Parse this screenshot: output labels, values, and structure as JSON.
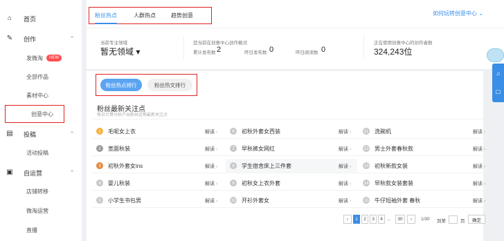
{
  "sidebar": {
    "items": [
      {
        "label": "首页",
        "icon": "home-icon"
      },
      {
        "label": "创作",
        "icon": "pen-icon"
      },
      {
        "label": "发微淘",
        "badge": "NEW"
      },
      {
        "label": "全部作品"
      },
      {
        "label": "素材中心"
      },
      {
        "label": "创意中心"
      },
      {
        "label": "投稿",
        "icon": "document-icon"
      },
      {
        "label": "活动投稿"
      },
      {
        "label": "自运营",
        "icon": "shop-icon"
      },
      {
        "label": "店铺转移"
      },
      {
        "label": "微淘运营"
      },
      {
        "label": "直播"
      }
    ]
  },
  "tabs": [
    "粉丝热点",
    "人群热点",
    "趋势创意"
  ],
  "help_link": "如何玩转创意中心 ⌄",
  "stats": {
    "domain_label": "当前专注领域",
    "domain_value": "暂无领域 ▾",
    "overview_label": "您当前在创意中心创作概况",
    "total_label": "累计发布数",
    "total_value": "2",
    "yesterday_pub_label": "昨日发布数",
    "yesterday_pub_value": "0",
    "yesterday_read_label": "昨日阅读数",
    "yesterday_read_value": "0",
    "users_label": "正在使用创意中心的创作者数",
    "users_value": "324,243位"
  },
  "rank_buttons": [
    "粉丝热点排行",
    "粉丝热文排行"
  ],
  "section": {
    "title": "粉丝最新关注点",
    "subtitle": "每日计算分析产出粉丝近期最新关注点"
  },
  "interpret_label": "解读",
  "hot_items": [
    {
      "num": "1",
      "text": "毛呢女上衣"
    },
    {
      "num": "2",
      "text": "宽面秋装"
    },
    {
      "num": "3",
      "text": "初秋外套女ins"
    },
    {
      "num": "4",
      "text": "婴儿秋装"
    },
    {
      "num": "5",
      "text": "小学生书包男"
    },
    {
      "num": "6",
      "text": "初秋外套女西装"
    },
    {
      "num": "7",
      "text": "早秋裤女网红"
    },
    {
      "num": "8",
      "text": "学生宿舍床上三件套"
    },
    {
      "num": "9",
      "text": "初秋女上衣外套"
    },
    {
      "num": "10",
      "text": "开衫外套女"
    },
    {
      "num": "11",
      "text": "洗碗机"
    },
    {
      "num": "12",
      "text": "男士外套春秋款"
    },
    {
      "num": "13",
      "text": "初秋新款女装"
    },
    {
      "num": "14",
      "text": "早秋款女装套装"
    },
    {
      "num": "15",
      "text": "牛仔短袖外套 春秋"
    }
  ],
  "pagination": {
    "prev": "‹",
    "pages": [
      "1",
      "2",
      "3",
      "4"
    ],
    "ellipsis": "...",
    "last": "30",
    "next": "›",
    "total_text": "1/30",
    "goto_label": "到第",
    "page_suffix": "页",
    "confirm": "确定"
  },
  "colors": {
    "accent": "#3a8ee6",
    "highlight": "#e02020"
  }
}
